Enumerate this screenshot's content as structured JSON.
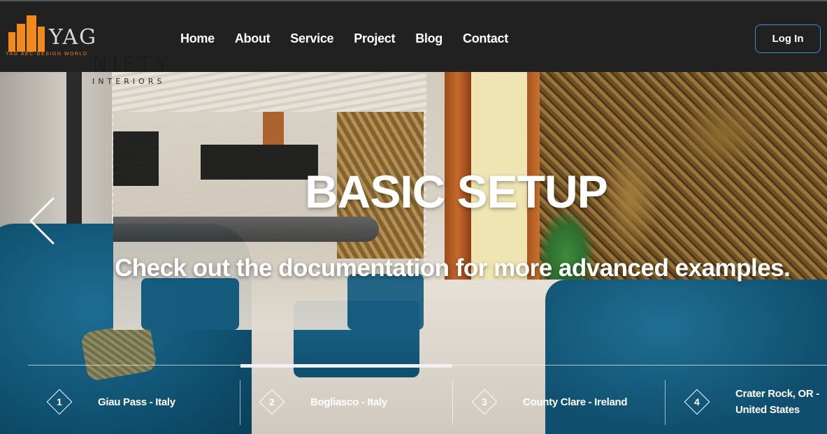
{
  "brand": {
    "name": "YAG",
    "tagline": "YAG AEC-DESIGN WORLD",
    "accent_color": "#f08a1e",
    "watermark_big": "NIFTY",
    "watermark_small": "INTERIORS"
  },
  "nav": {
    "items": [
      "Home",
      "About",
      "Service",
      "Project",
      "Blog",
      "Contact"
    ],
    "login_label": "Log In",
    "login_border_color": "#3a8fd6"
  },
  "hero": {
    "title": "BASIC SETUP",
    "subtitle": "Check out the documentation for more advanced examples.",
    "prev_icon": "chevron-left-icon"
  },
  "slider": {
    "items": [
      {
        "number": "1",
        "label": "Giau Pass - Italy"
      },
      {
        "number": "2",
        "label": "Bogliasco - Italy"
      },
      {
        "number": "3",
        "label": "County Clare - Ireland"
      },
      {
        "number": "4",
        "label": "Crater Rock, OR - United States"
      }
    ]
  }
}
